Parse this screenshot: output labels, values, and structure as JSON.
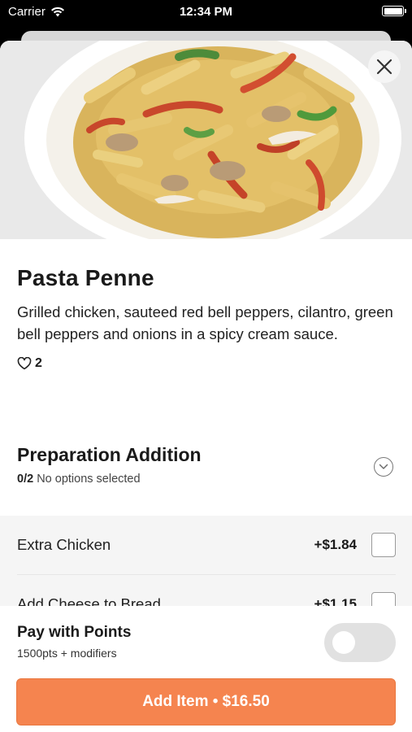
{
  "status_bar": {
    "carrier": "Carrier",
    "time": "12:34 PM"
  },
  "item": {
    "title": "Pasta Penne",
    "description": "Grilled chicken, sauteed red bell peppers, cilantro, green bell peppers and onions in a spicy cream sauce.",
    "likes": "2"
  },
  "section": {
    "title": "Preparation Addition",
    "count": "0/2",
    "status": "No options selected"
  },
  "options": [
    {
      "name": "Extra Chicken",
      "price": "+$1.84"
    },
    {
      "name": "Add Cheese to Bread",
      "price": "+$1.15"
    }
  ],
  "footer": {
    "points_title": "Pay with Points",
    "points_sub": "1500pts + modifiers",
    "add_button": "Add Item • $16.50"
  },
  "colors": {
    "accent": "#f5844f",
    "toggle_off": "#e1e1e1"
  },
  "icons": [
    "wifi-icon",
    "battery-icon",
    "close-icon",
    "heart-icon",
    "chevron-down-icon"
  ]
}
